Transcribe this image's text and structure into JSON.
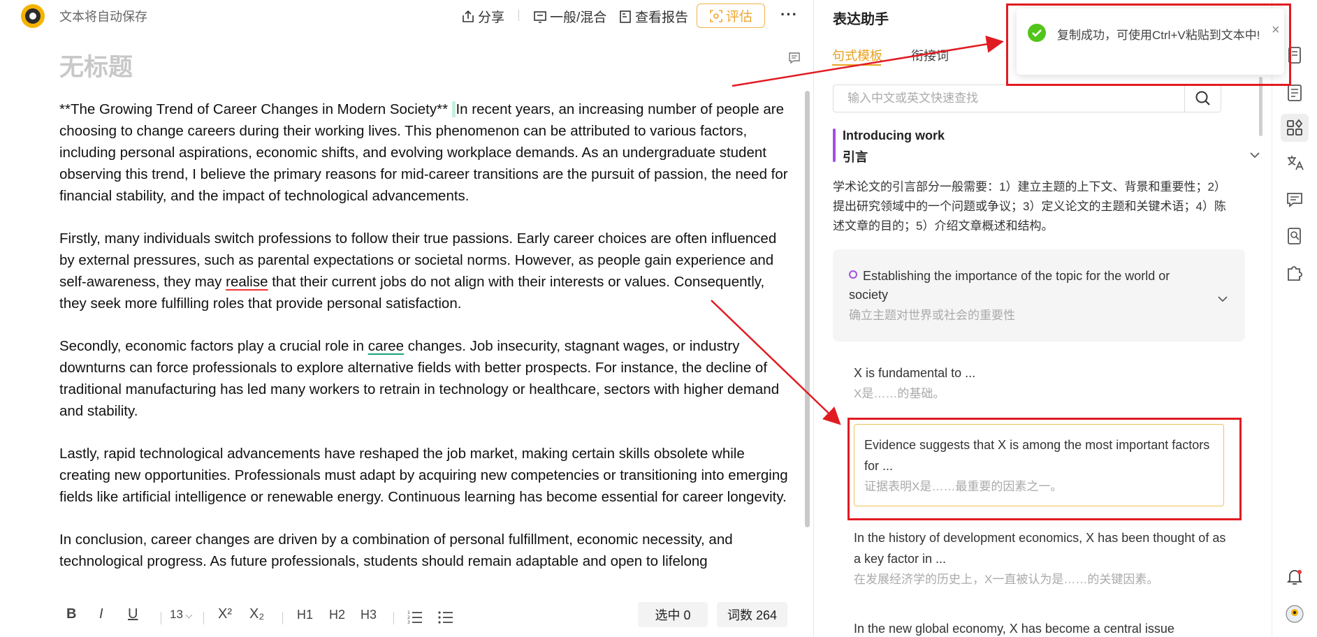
{
  "header": {
    "autosave": "文本将自动保存",
    "share": "分享",
    "mode": "一般/混合",
    "report": "查看报告",
    "evaluate": "评估",
    "more": "···"
  },
  "doc": {
    "title": "无标题",
    "paragraphs": [
      {
        "a": "**The Growing Trend of Career Changes in Modern Society** ",
        "b": "In recent years, an increasing number of people are choosing to change careers during their working lives. This phenomenon can be attributed to various factors, including personal aspirations, economic shifts, and evolving workplace demands. As an undergraduate student observing this trend, I believe the primary reasons for mid-career transitions are the pursuit of passion, the need for financial stability, and the impact of technological advancements."
      },
      {
        "a": "Firstly, many individuals switch professions to follow their true passions. Early career choices are often influenced by external pressures, such as parental expectations or societal norms. However, as people gain experience and self-awareness, they may ",
        "u": "realise",
        "b": " that their current jobs do not align with their interests or values. Consequently, they seek more fulfilling roles that provide personal satisfaction."
      },
      {
        "a": "Secondly, economic factors play a crucial role in ",
        "u": "caree",
        "b": " changes. Job insecurity, stagnant wages, or industry downturns can force professionals to explore alternative fields with better prospects. For instance, the decline of traditional manufacturing has led many workers to retrain in technology or healthcare, sectors with higher demand and stability."
      },
      {
        "a": "Lastly, rapid technological advancements have reshaped the job market, making certain skills obsolete while creating new opportunities. Professionals must adapt by acquiring new competencies or transitioning into emerging fields like artificial intelligence or renewable energy. Continuous learning has become essential for career longevity."
      },
      {
        "a": "In conclusion, career changes are driven by a combination of personal fulfillment, economic necessity, and technological progress. As future professionals, students should remain adaptable and open to lifelong"
      }
    ]
  },
  "toolbar": {
    "bold": "B",
    "italic": "I",
    "underline": "U",
    "font_size": "13",
    "sup": "X²",
    "sub": "X₂",
    "h1": "H1",
    "h2": "H2",
    "h3": "H3",
    "selected": "选中 0",
    "wordcount": "词数 264"
  },
  "assistant": {
    "title": "表达助手",
    "tabs": [
      "句式模板",
      "衔接词"
    ],
    "search_placeholder": "输入中文或英文快速查找",
    "section": {
      "en": "Introducing work",
      "zh": "引言",
      "desc": "学术论文的引言部分一般需要：1）建立主题的上下文、背景和重要性；2）提出研究领域中的一个问题或争议；3）定义论文的主题和关键术语；4）陈述文章的目的；5）介绍文章概述和结构。"
    },
    "subsection": {
      "en": "Establishing the importance of the topic for the world or society",
      "zh": "确立主题对世界或社会的重要性"
    },
    "phrases": [
      {
        "en": "X is fundamental to ...",
        "zh": "X是……的基础。"
      },
      {
        "en": "Evidence suggests that X is among the most important factors for ...",
        "zh": "证据表明X是……最重要的因素之一。"
      },
      {
        "en": "In the history of development economics, X has been thought of as a key factor in ...",
        "zh": "在发展经济学的历史上，X一直被认为是……的关键因素。"
      },
      {
        "en": "In the new global economy, X has become a central issue"
      }
    ]
  },
  "toast": {
    "message": "复制成功，可使用Ctrl+V粘贴到文本中!",
    "close": "×"
  },
  "colors": {
    "accent": "#e8a021",
    "purple": "#a34ee6",
    "annotation_red": "#e11b22",
    "success_green": "#52c41a"
  }
}
